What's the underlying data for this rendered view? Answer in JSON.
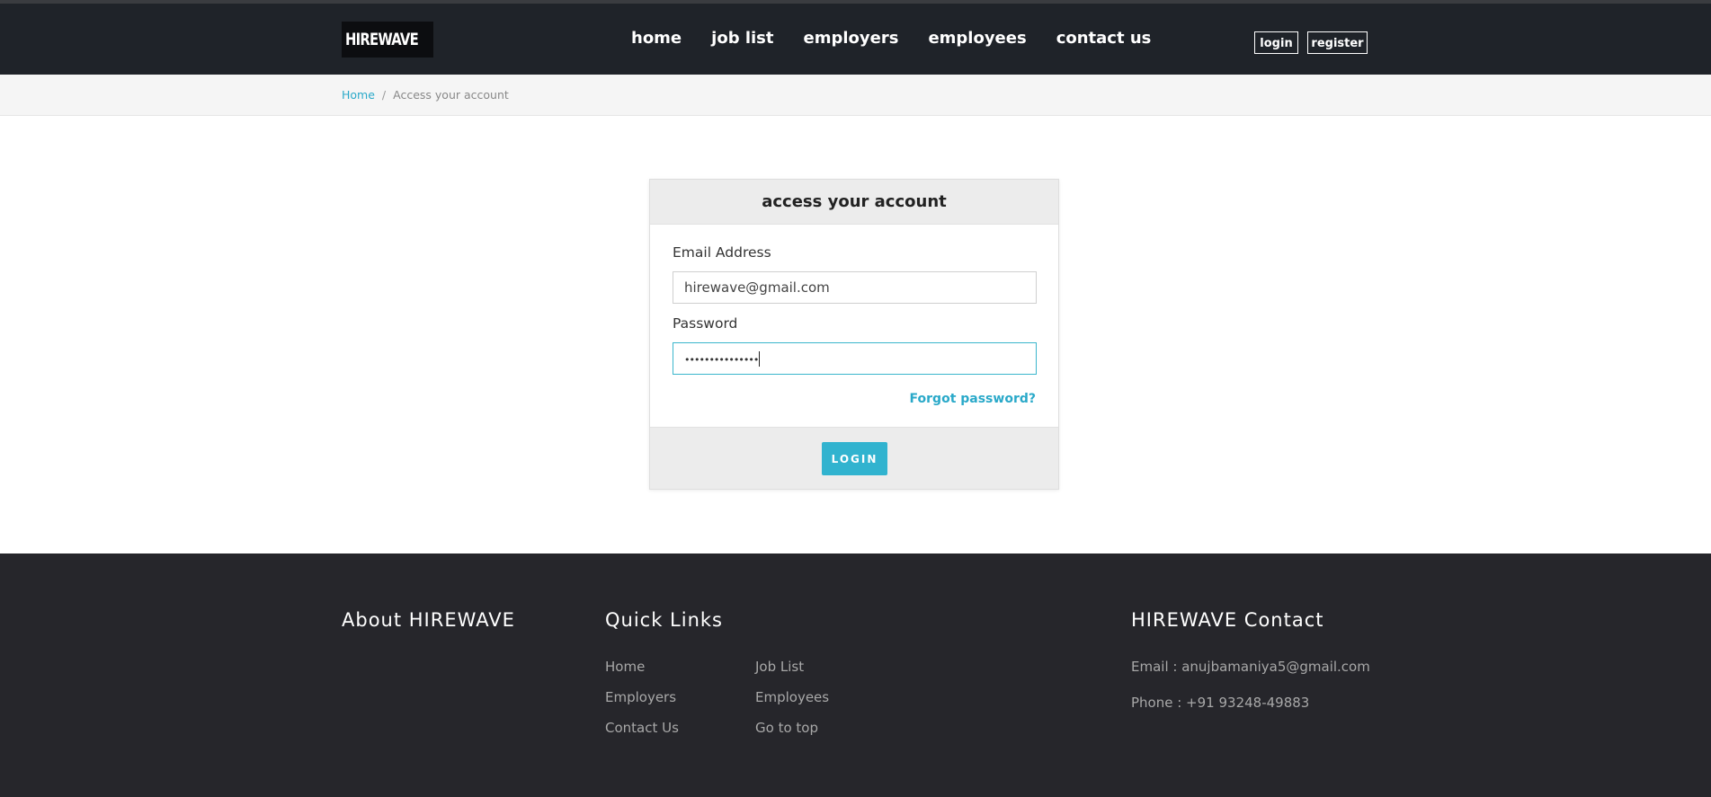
{
  "brand": {
    "logo_text": "HIREWAVE",
    "accent": "#31b3cf",
    "nav_bg": "#1f2329",
    "footer_bg": "#26262b"
  },
  "nav": {
    "links": [
      "home",
      "job list",
      "employers",
      "employees",
      "contact us"
    ],
    "login": "login",
    "register": "register"
  },
  "breadcrumb": {
    "home": "Home",
    "separator": "/",
    "current": "Access your account"
  },
  "form": {
    "title": "access your account",
    "email_label": "Email Address",
    "email_value": "hirewave@gmail.com",
    "password_label": "Password",
    "password_value": "•••••••••••••••",
    "forgot": "Forgot password?",
    "submit": "LOGIN"
  },
  "footer": {
    "about_title": "About HIREWAVE",
    "links_title": "Quick Links",
    "links": [
      "Home",
      "Job List",
      "Employers",
      "Employees",
      "Contact Us",
      "Go to top"
    ],
    "contact_title": "HIREWAVE Contact",
    "email": "Email : anujbamaniya5@gmail.com",
    "phone": "Phone : +91 93248-49883"
  }
}
